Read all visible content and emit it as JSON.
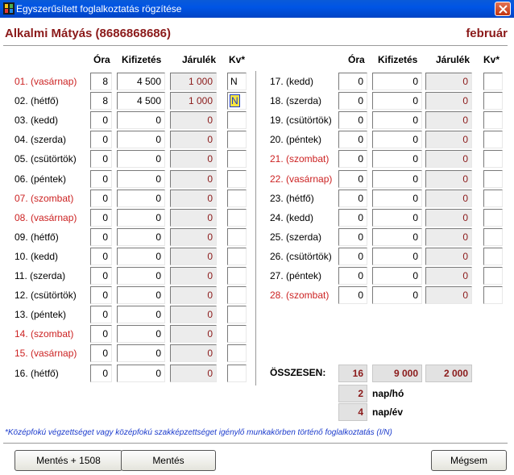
{
  "window": {
    "title": "Egyszerűsített foglalkoztatás rögzítése"
  },
  "header": {
    "name": "Alkalmi Mátyás (8686868686)",
    "month": "február"
  },
  "columns": {
    "ora": "Óra",
    "kifizetes": "Kifizetés",
    "jarulek": "Járulék",
    "kv": "Kv*"
  },
  "left_rows": [
    {
      "day": "01. (vasárnap)",
      "weekend": true,
      "ora": "8",
      "kifizetes": "4 500",
      "jarulek": "1 000",
      "kv": "N"
    },
    {
      "day": "02. (hétfő)",
      "weekend": false,
      "ora": "8",
      "kifizetes": "4 500",
      "jarulek": "1 000",
      "kv": "N"
    },
    {
      "day": "03. (kedd)",
      "weekend": false,
      "ora": "0",
      "kifizetes": "0",
      "jarulek": "0",
      "kv": ""
    },
    {
      "day": "04. (szerda)",
      "weekend": false,
      "ora": "0",
      "kifizetes": "0",
      "jarulek": "0",
      "kv": ""
    },
    {
      "day": "05. (csütörtök)",
      "weekend": false,
      "ora": "0",
      "kifizetes": "0",
      "jarulek": "0",
      "kv": ""
    },
    {
      "day": "06. (péntek)",
      "weekend": false,
      "ora": "0",
      "kifizetes": "0",
      "jarulek": "0",
      "kv": ""
    },
    {
      "day": "07. (szombat)",
      "weekend": true,
      "ora": "0",
      "kifizetes": "0",
      "jarulek": "0",
      "kv": ""
    },
    {
      "day": "08. (vasárnap)",
      "weekend": true,
      "ora": "0",
      "kifizetes": "0",
      "jarulek": "0",
      "kv": ""
    },
    {
      "day": "09. (hétfő)",
      "weekend": false,
      "ora": "0",
      "kifizetes": "0",
      "jarulek": "0",
      "kv": ""
    },
    {
      "day": "10. (kedd)",
      "weekend": false,
      "ora": "0",
      "kifizetes": "0",
      "jarulek": "0",
      "kv": ""
    },
    {
      "day": "11. (szerda)",
      "weekend": false,
      "ora": "0",
      "kifizetes": "0",
      "jarulek": "0",
      "kv": ""
    },
    {
      "day": "12. (csütörtök)",
      "weekend": false,
      "ora": "0",
      "kifizetes": "0",
      "jarulek": "0",
      "kv": ""
    },
    {
      "day": "13. (péntek)",
      "weekend": false,
      "ora": "0",
      "kifizetes": "0",
      "jarulek": "0",
      "kv": ""
    },
    {
      "day": "14. (szombat)",
      "weekend": true,
      "ora": "0",
      "kifizetes": "0",
      "jarulek": "0",
      "kv": ""
    },
    {
      "day": "15. (vasárnap)",
      "weekend": true,
      "ora": "0",
      "kifizetes": "0",
      "jarulek": "0",
      "kv": ""
    },
    {
      "day": "16. (hétfő)",
      "weekend": false,
      "ora": "0",
      "kifizetes": "0",
      "jarulek": "0",
      "kv": ""
    }
  ],
  "right_rows": [
    {
      "day": "17. (kedd)",
      "weekend": false,
      "ora": "0",
      "kifizetes": "0",
      "jarulek": "0",
      "kv": ""
    },
    {
      "day": "18. (szerda)",
      "weekend": false,
      "ora": "0",
      "kifizetes": "0",
      "jarulek": "0",
      "kv": ""
    },
    {
      "day": "19. (csütörtök)",
      "weekend": false,
      "ora": "0",
      "kifizetes": "0",
      "jarulek": "0",
      "kv": ""
    },
    {
      "day": "20. (péntek)",
      "weekend": false,
      "ora": "0",
      "kifizetes": "0",
      "jarulek": "0",
      "kv": ""
    },
    {
      "day": "21. (szombat)",
      "weekend": true,
      "ora": "0",
      "kifizetes": "0",
      "jarulek": "0",
      "kv": ""
    },
    {
      "day": "22. (vasárnap)",
      "weekend": true,
      "ora": "0",
      "kifizetes": "0",
      "jarulek": "0",
      "kv": ""
    },
    {
      "day": "23. (hétfő)",
      "weekend": false,
      "ora": "0",
      "kifizetes": "0",
      "jarulek": "0",
      "kv": ""
    },
    {
      "day": "24. (kedd)",
      "weekend": false,
      "ora": "0",
      "kifizetes": "0",
      "jarulek": "0",
      "kv": ""
    },
    {
      "day": "25. (szerda)",
      "weekend": false,
      "ora": "0",
      "kifizetes": "0",
      "jarulek": "0",
      "kv": ""
    },
    {
      "day": "26. (csütörtök)",
      "weekend": false,
      "ora": "0",
      "kifizetes": "0",
      "jarulek": "0",
      "kv": ""
    },
    {
      "day": "27. (péntek)",
      "weekend": false,
      "ora": "0",
      "kifizetes": "0",
      "jarulek": "0",
      "kv": ""
    },
    {
      "day": "28. (szombat)",
      "weekend": true,
      "ora": "0",
      "kifizetes": "0",
      "jarulek": "0",
      "kv": ""
    }
  ],
  "totals": {
    "label": "ÖSSZESEN:",
    "ora": "16",
    "kifizetes": "9 000",
    "jarulek": "2 000",
    "nap_ho": "2",
    "nap_ho_label": "nap/hó",
    "nap_ev": "4",
    "nap_ev_label": "nap/év"
  },
  "footnote": "*Középfokú végzettséget vagy középfokú szakképzettséget igénylő munkakörben történő foglalkoztatás (I/N)",
  "buttons": {
    "save_1508": "Mentés + 1508",
    "save": "Mentés",
    "cancel": "Mégsem"
  },
  "colors": {
    "titlebar": "#0055e5",
    "accent": "#8b1a1a",
    "weekend": "#cc2222",
    "footnote": "#1a3acc"
  }
}
